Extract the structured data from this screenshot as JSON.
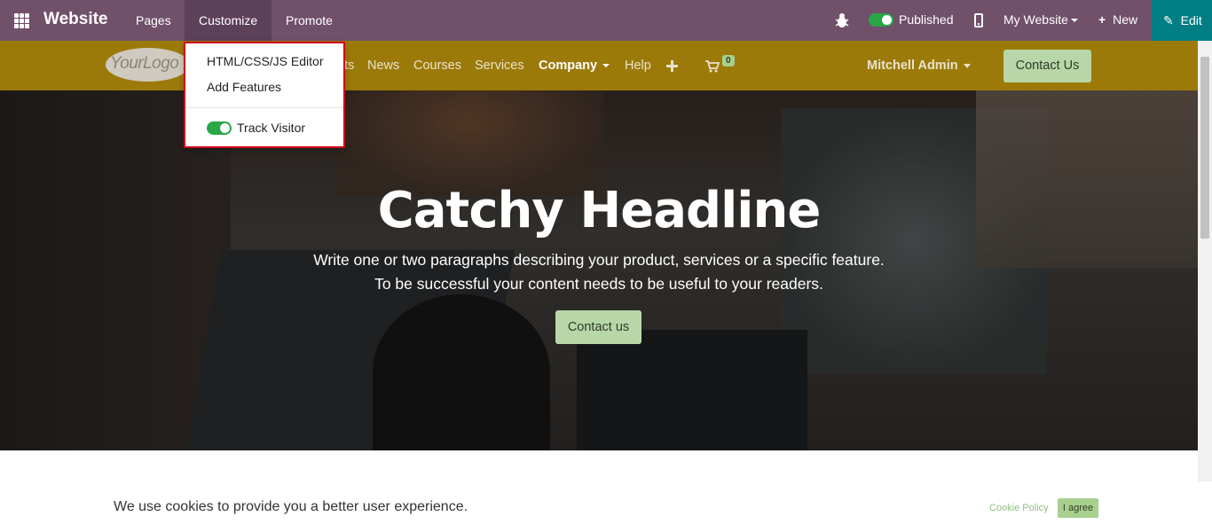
{
  "admin_bar": {
    "app_name": "Website",
    "menus": [
      "Pages",
      "Customize",
      "Promote"
    ],
    "published_label": "Published",
    "website_selector": "My Website",
    "new_label": "New",
    "edit_label": "Edit",
    "colors": {
      "bar": "#71506a",
      "edit": "#017e84",
      "toggle_on": "#28a745"
    }
  },
  "customize_menu": {
    "items": [
      "HTML/CSS/JS Editor",
      "Add Features"
    ],
    "track_visitor_label": "Track Visitor",
    "track_visitor_enabled": true
  },
  "site_nav": {
    "logo_text": "YourLogo",
    "links": [
      "ts",
      "News",
      "Courses",
      "Services",
      "Company",
      "Help"
    ],
    "active_link": "Company",
    "cart_count": "0",
    "user_name": "Mitchell Admin",
    "contact_button": "Contact Us",
    "colors": {
      "bar": "#9c7a0a",
      "button": "#b7d7a8"
    }
  },
  "hero": {
    "headline": "Catchy Headline",
    "line1": "Write one or two paragraphs describing your product, services or a specific feature.",
    "line2": "To be successful your content needs to be useful to your readers.",
    "button": "Contact us"
  },
  "cookie_bar": {
    "message": "We use cookies to provide you a better user experience.",
    "policy_link": "Cookie Policy",
    "agree_button": "I agree"
  }
}
